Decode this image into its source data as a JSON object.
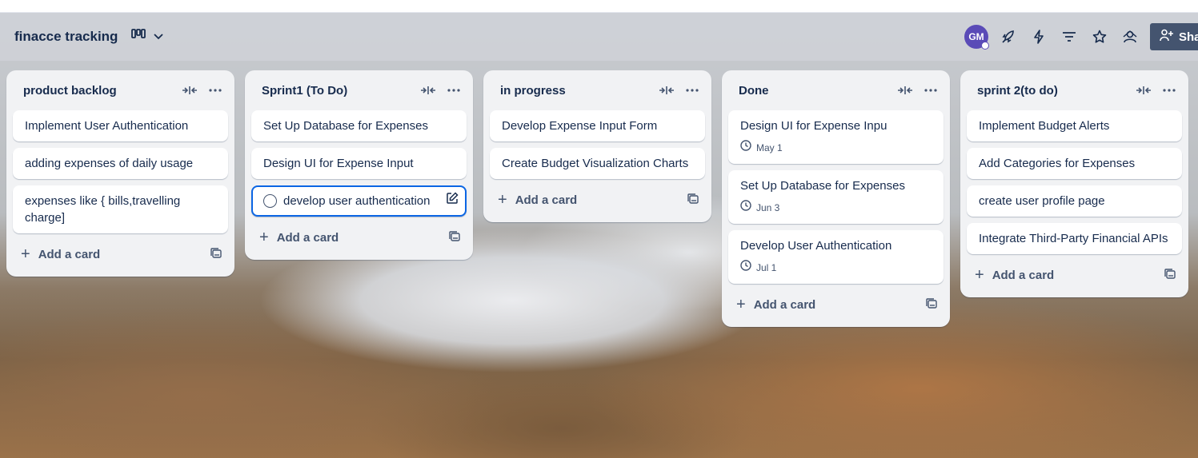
{
  "board": {
    "title": "finacce tracking",
    "view_icon": "board-view-icon",
    "avatar_initials": "GM",
    "share_label": "Share"
  },
  "header_icons": [
    "rocket-icon",
    "lightning-icon",
    "filter-icon",
    "star-icon",
    "people-icon"
  ],
  "colors": {
    "share_button": "#44546f",
    "avatar": "#5a4bb7",
    "edit_border": "#0c66e4"
  },
  "add_card_label": "Add a card",
  "lists": [
    {
      "title": "product backlog",
      "cards": [
        {
          "text": "Implement User Authentication"
        },
        {
          "text": "adding expenses of daily usage"
        },
        {
          "text": "expenses like { bills,travelling charge]"
        }
      ]
    },
    {
      "title": "Sprint1 (To Do)",
      "cards": [
        {
          "text": "Set Up Database for Expenses"
        },
        {
          "text": "Design UI for Expense Input"
        },
        {
          "text": "develop user authentication",
          "editing": true
        }
      ]
    },
    {
      "title": "in progress",
      "cards": [
        {
          "text": "Develop Expense Input Form"
        },
        {
          "text": "Create Budget Visualization Charts"
        }
      ]
    },
    {
      "title": "Done",
      "cards": [
        {
          "text": "Design UI for Expense Inpu",
          "date": "May 1"
        },
        {
          "text": "Set Up Database for Expenses",
          "date": "Jun 3"
        },
        {
          "text": "Develop User Authentication",
          "date": "Jul 1"
        }
      ]
    },
    {
      "title": "sprint 2(to do)",
      "cards": [
        {
          "text": "Implement Budget Alerts"
        },
        {
          "text": "Add Categories for Expenses"
        },
        {
          "text": "create user profile page"
        },
        {
          "text": "Integrate Third-Party Financial APIs"
        }
      ]
    }
  ]
}
